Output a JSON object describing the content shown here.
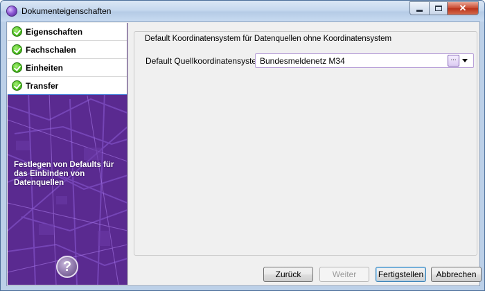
{
  "window": {
    "title": "Dokumenteigenschaften",
    "icons": {
      "app": "purple-orb-icon",
      "minimize": "minimize-icon",
      "maximize": "maximize-icon",
      "close": "close-icon"
    }
  },
  "sidebar": {
    "items": [
      {
        "label": "Eigenschaften",
        "icon": "check-icon"
      },
      {
        "label": "Fachschalen",
        "icon": "check-icon"
      },
      {
        "label": "Einheiten",
        "icon": "check-icon"
      },
      {
        "label": "Transfer",
        "icon": "check-icon",
        "selected": true
      }
    ],
    "description": "Festlegen von Defaults für das Einbinden von Datenquellen",
    "help_icon": "help-icon",
    "colors": {
      "background": "#5a2a90",
      "check": "#4fc21f"
    }
  },
  "main": {
    "group_title": "Default Koordinatensystem für Datenquellen ohne Koordinatensystem",
    "field_label": "Default Quellkoordinatensystem",
    "field_value": "Bundesmeldenetz M34",
    "browse_label": "..."
  },
  "buttons": {
    "back": "Zurück",
    "next": "Weiter",
    "finish": "Fertigstellen",
    "cancel": "Abbrechen"
  }
}
